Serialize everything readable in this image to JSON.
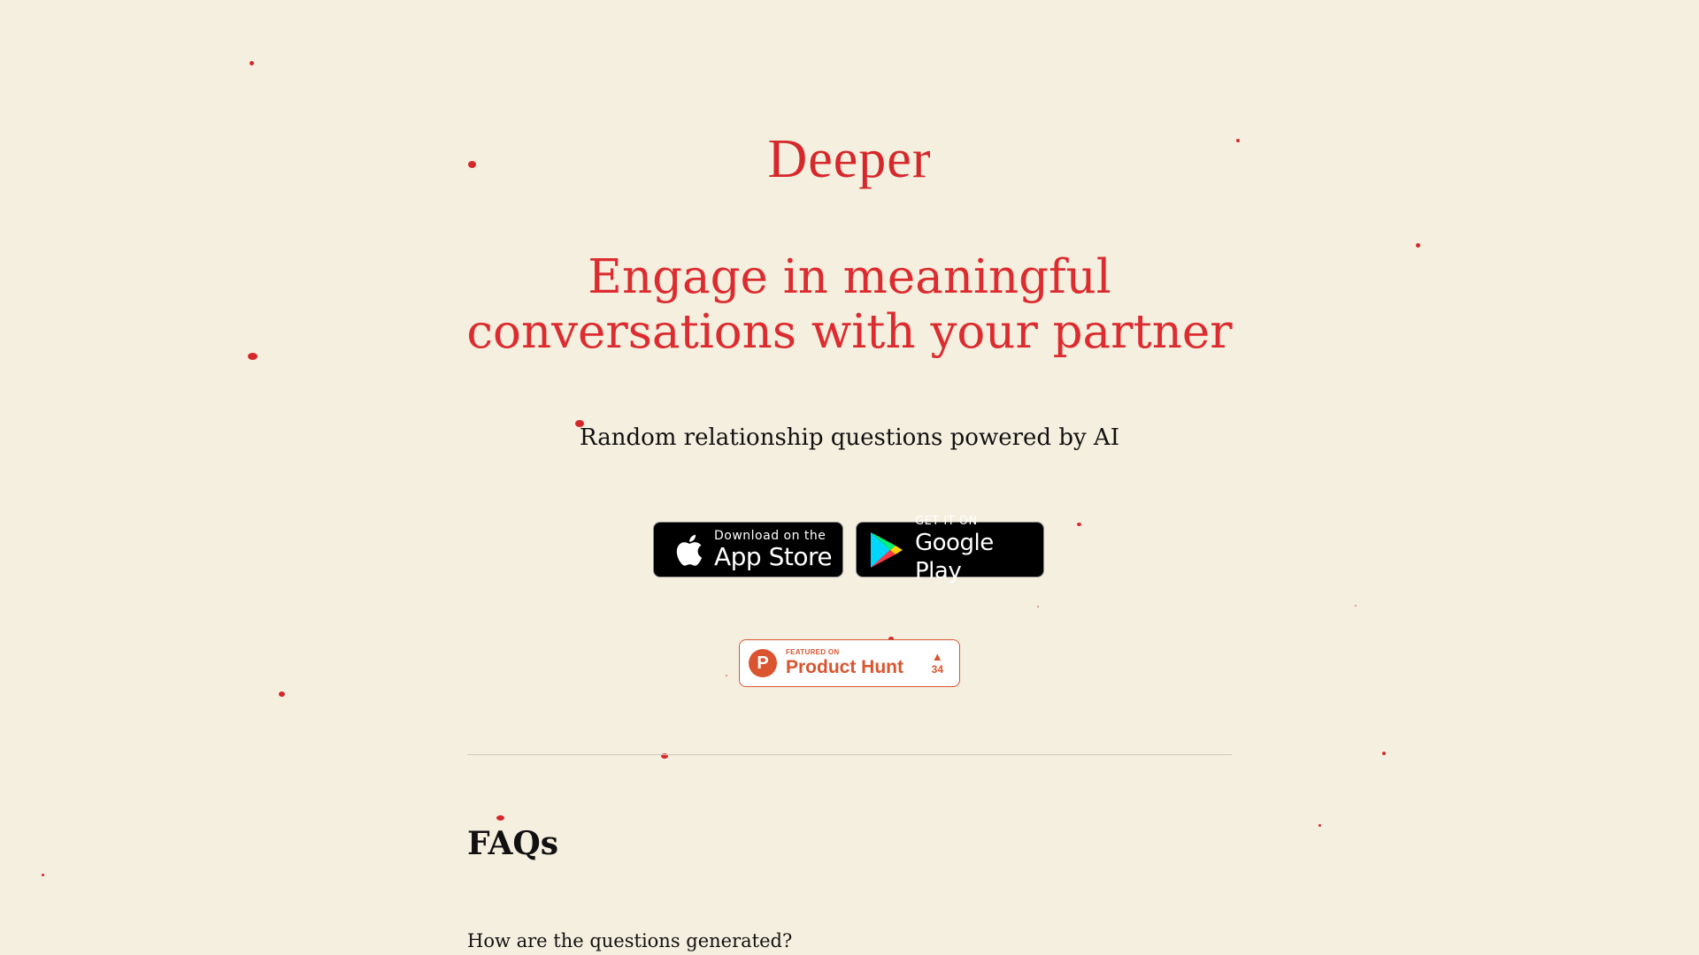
{
  "brand": {
    "name": "Deeper",
    "accent_color": "#d6282b"
  },
  "hero": {
    "headline_line1": "Engage in meaningful",
    "headline_line2": "conversations with your partner",
    "subtitle": "Random relationship questions powered by AI"
  },
  "downloads": {
    "app_store": {
      "small": "Download on the",
      "big": "App Store",
      "icon": "apple-icon"
    },
    "google_play": {
      "small": "GET IT ON",
      "big": "Google Play",
      "icon": "google-play-icon"
    }
  },
  "product_hunt": {
    "logo_letter": "P",
    "small": "FEATURED ON",
    "big": "Product Hunt",
    "arrow": "▲",
    "votes": "34",
    "color": "#da552f"
  },
  "faq": {
    "title": "FAQs",
    "questions": [
      "How are the questions generated?"
    ]
  }
}
